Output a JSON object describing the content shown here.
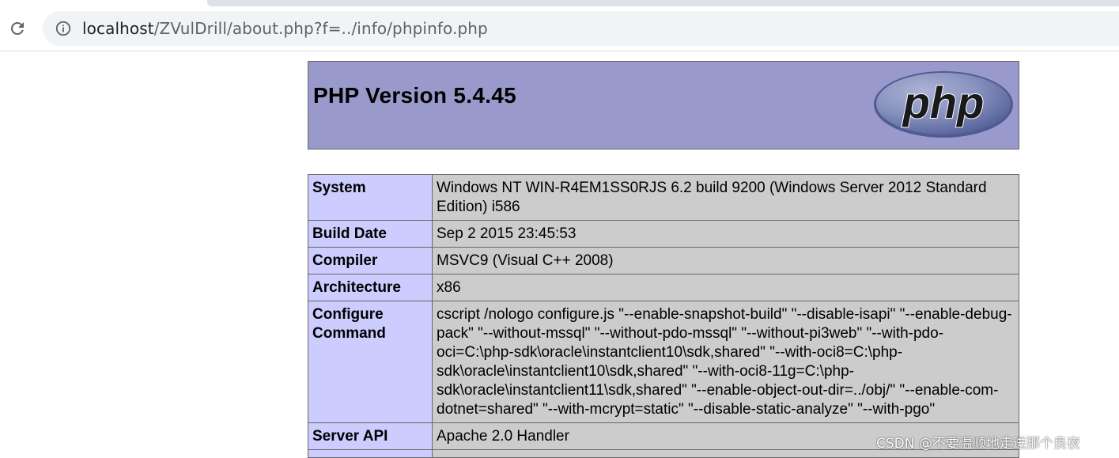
{
  "browser": {
    "url_host": "localhost",
    "url_path": "/ZVulDrill/about.php?f=../info/phpinfo.php",
    "reload_icon": "reload-icon",
    "info_icon": "info-icon"
  },
  "phpinfo": {
    "title": "PHP Version 5.4.45",
    "logo_text": "php",
    "rows": [
      {
        "key": "System",
        "value": "Windows NT WIN-R4EM1SS0RJS 6.2 build 9200 (Windows Server 2012 Standard Edition) i586"
      },
      {
        "key": "Build Date",
        "value": "Sep 2 2015 23:45:53"
      },
      {
        "key": "Compiler",
        "value": "MSVC9 (Visual C++ 2008)"
      },
      {
        "key": "Architecture",
        "value": "x86"
      },
      {
        "key": "Configure Command",
        "value": "cscript /nologo configure.js \"--enable-snapshot-build\" \"--disable-isapi\" \"--enable-debug-pack\" \"--without-mssql\" \"--without-pdo-mssql\" \"--without-pi3web\" \"--with-pdo-oci=C:\\php-sdk\\oracle\\instantclient10\\sdk,shared\" \"--with-oci8=C:\\php-sdk\\oracle\\instantclient10\\sdk,shared\" \"--with-oci8-11g=C:\\php-sdk\\oracle\\instantclient11\\sdk,shared\" \"--enable-object-out-dir=../obj/\" \"--enable-com-dotnet=shared\" \"--with-mcrypt=static\" \"--disable-static-analyze\" \"--with-pgo\""
      },
      {
        "key": "Server API",
        "value": "Apache 2.0 Handler"
      },
      {
        "key": "",
        "value": ""
      }
    ]
  },
  "watermark": "CSDN @不要温顺地走进那个良夜",
  "colors": {
    "header_bg": "#9999cc",
    "key_bg": "#ccccff",
    "value_bg": "#cccccc"
  }
}
